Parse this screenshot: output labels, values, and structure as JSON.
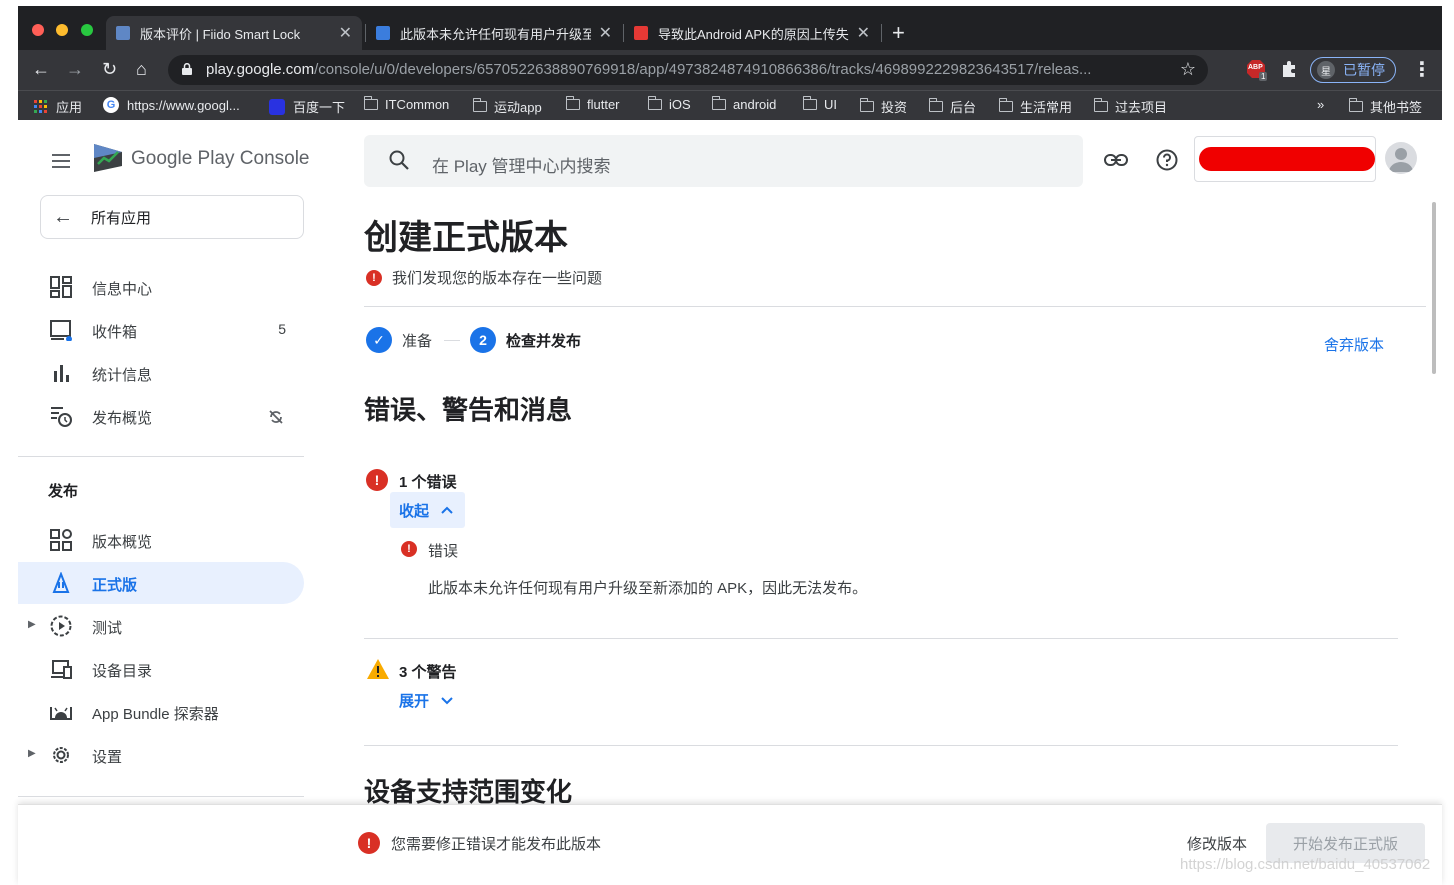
{
  "browser": {
    "tabs": [
      {
        "title": "版本评价 | Fiido Smart Lock",
        "close": "✕"
      },
      {
        "title": "此版本未允许任何现有用户升级至新添加的APK",
        "close": "✕"
      },
      {
        "title": "导致此Android APK的原因上传失败",
        "close": "✕"
      }
    ],
    "new_tab": "+",
    "url_host": "play.google.com",
    "url_path": "/console/u/0/developers/6570522638890769918/app/4973824874910866386/tracks/4698992229823643517/releas...",
    "abp_label": "ABP",
    "abp_count": "1",
    "profile_label": "已暂停",
    "profile_initial": "星",
    "bookmarks": [
      "应用",
      "https://www.googl...",
      "百度一下",
      "ITCommon",
      "运动app",
      "flutter",
      "iOS",
      "android",
      "UI",
      "投资",
      "后台",
      "生活常用",
      "过去项目"
    ],
    "more_bookmarks": "»",
    "other_bookmarks": "其他书签"
  },
  "sidebar": {
    "logo_text": "Google Play Console",
    "all_apps": "所有应用",
    "top_items": [
      {
        "label": "信息中心",
        "count": ""
      },
      {
        "label": "收件箱",
        "count": "5"
      },
      {
        "label": "统计信息",
        "count": ""
      },
      {
        "label": "发布概览",
        "count": ""
      }
    ],
    "section": "发布",
    "release_items": [
      {
        "label": "版本概览"
      },
      {
        "label": "正式版"
      },
      {
        "label": "测试"
      },
      {
        "label": "设备目录"
      },
      {
        "label": "App Bundle 探索器"
      },
      {
        "label": "设置"
      }
    ]
  },
  "header": {
    "search_placeholder": "在 Play 管理中心内搜索"
  },
  "main": {
    "title": "创建正式版本",
    "issue_text": "我们发现您的版本存在一些问题",
    "steps": [
      {
        "num": "✓",
        "label": "准备"
      },
      {
        "num": "2",
        "label": "检查并发布"
      }
    ],
    "discard": "舍弃版本",
    "section_title": "错误、警告和消息",
    "errors_count": "1 个错误",
    "collapse": "收起",
    "error_label": "错误",
    "error_message": "此版本未允许任何现有用户升级至新添加的 APK，因此无法发布。",
    "warnings_count": "3 个警告",
    "expand": "展开",
    "next_section": "设备支持范围变化"
  },
  "footer": {
    "message": "您需要修正错误才能发布此版本",
    "edit": "修改版本",
    "start": "开始发布正式版"
  },
  "watermark": "https://blog.csdn.net/baidu_40537062",
  "colors": {
    "accent": "#1a73e8",
    "error": "#d93025",
    "warning": "#f9ab00",
    "chrome_dark": "#202124",
    "active_nav_bg": "#e8f0fe"
  }
}
